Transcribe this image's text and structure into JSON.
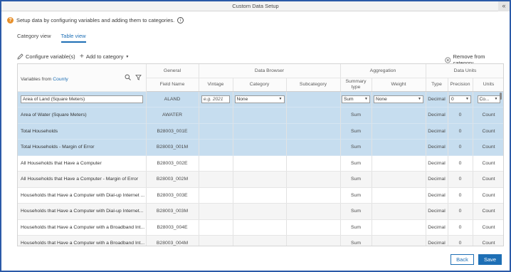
{
  "window": {
    "title": "Custom Data Setup"
  },
  "info": {
    "text": "Setup data by configuring variables and adding them to categories."
  },
  "tabs": [
    {
      "label": "Category view",
      "active": false
    },
    {
      "label": "Table view",
      "active": true
    }
  ],
  "toolbar": {
    "configure_label": "Configure variable(s)",
    "add_label": "Add to category",
    "remove_label": "Remove from category"
  },
  "table": {
    "group_headers": {
      "general": "General",
      "data_browser": "Data Browser",
      "aggregation": "Aggregation",
      "data_units": "Data Units"
    },
    "variables_from": "Variables from",
    "variables_from_link": "County",
    "columns": {
      "field_name": "Field Name",
      "vintage": "Vintage",
      "category": "Category",
      "subcategory": "Subcategory",
      "summary_type": "Summary type",
      "weight": "Weight",
      "type": "Type",
      "precision": "Precision",
      "units": "Units"
    },
    "editor_row": {
      "name": "Area of Land (Square Meters)",
      "field": "ALAND",
      "vintage_placeholder": "e.g. 2021",
      "category": "None",
      "summary": "Sum",
      "weight": "None",
      "type": "Decimal",
      "precision": "0",
      "units": "Co..."
    },
    "rows": [
      {
        "name": "Area of Water (Square Meters)",
        "field": "AWATER",
        "summary": "Sum",
        "type": "Decimal",
        "precision": "0",
        "units": "Count",
        "selected": true
      },
      {
        "name": "Total Households",
        "field": "B28003_001E",
        "summary": "Sum",
        "type": "Decimal",
        "precision": "0",
        "units": "Count",
        "selected": true
      },
      {
        "name": "Total Households - Margin of Error",
        "field": "B28003_001M",
        "summary": "Sum",
        "type": "Decimal",
        "precision": "0",
        "units": "Count",
        "selected": true
      },
      {
        "name": "All Households that Have a Computer",
        "field": "B28003_002E",
        "summary": "Sum",
        "type": "Decimal",
        "precision": "0",
        "units": "Count",
        "selected": false
      },
      {
        "name": "All Households that Have a Computer - Margin of Error",
        "field": "B28003_002M",
        "summary": "Sum",
        "type": "Decimal",
        "precision": "0",
        "units": "Count",
        "selected": false
      },
      {
        "name": "Households that Have a Computer with Dial-up Internet ...",
        "field": "B28003_003E",
        "summary": "Sum",
        "type": "Decimal",
        "precision": "0",
        "units": "Count",
        "selected": false
      },
      {
        "name": "Households that Have a Computer with Dial-up Internet...",
        "field": "B28003_003M",
        "summary": "Sum",
        "type": "Decimal",
        "precision": "0",
        "units": "Count",
        "selected": false
      },
      {
        "name": "Households that Have a Computer with a Broadband Int...",
        "field": "B28003_004E",
        "summary": "Sum",
        "type": "Decimal",
        "precision": "0",
        "units": "Count",
        "selected": false
      },
      {
        "name": "Households that Have a Computer with a Broadband Int...",
        "field": "B28003_004M",
        "summary": "Sum",
        "type": "Decimal",
        "precision": "0",
        "units": "Count",
        "selected": false
      }
    ]
  },
  "footer": {
    "back_label": "Back",
    "save_label": "Save"
  },
  "colors": {
    "accent": "#1e6fb5",
    "selected_row": "#c6ddef",
    "info": "#e8912c",
    "frame": "#2b5aa8"
  }
}
